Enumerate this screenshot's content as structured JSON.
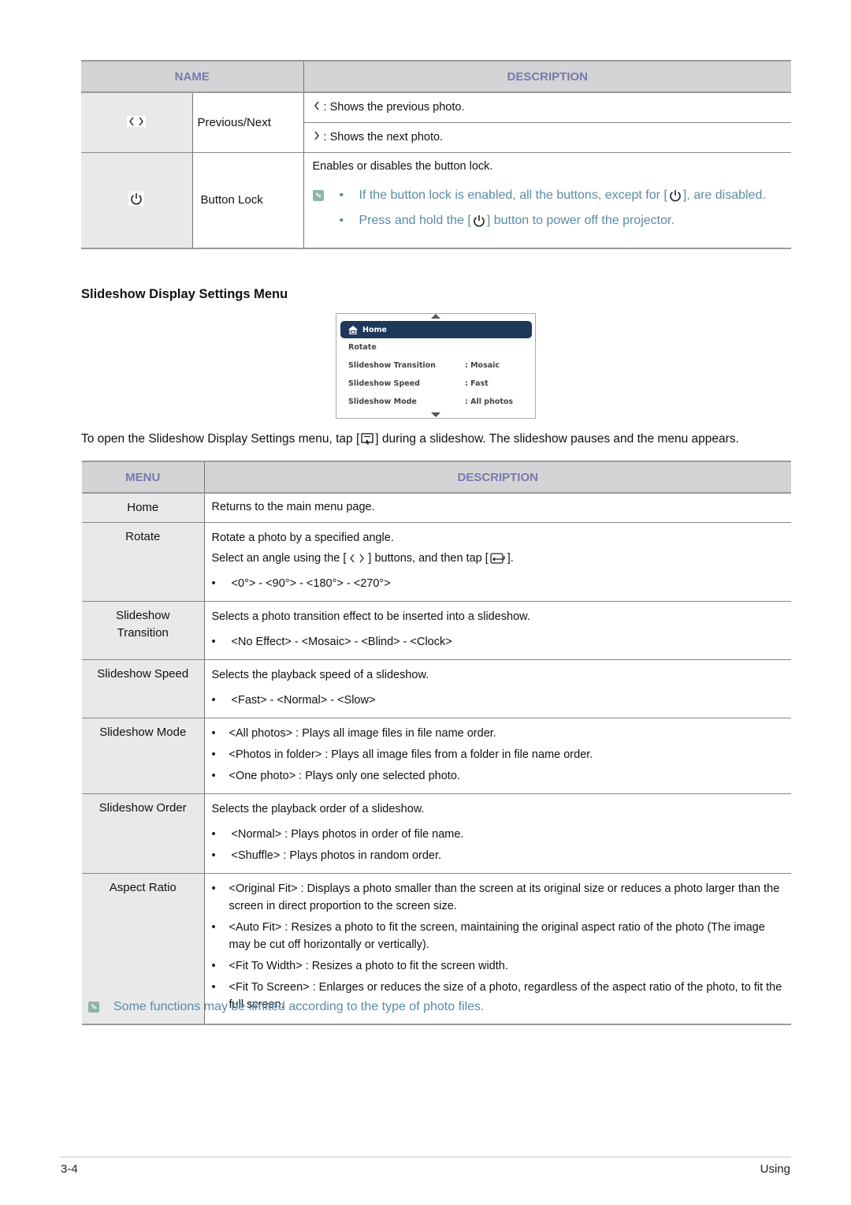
{
  "table1": {
    "headers": {
      "name": "NAME",
      "description": "DESCRIPTION"
    },
    "rows": [
      {
        "icon": "chevron-left-right-icon",
        "name": "Previous/Next",
        "descriptions": [
          {
            "icon": "chevron-left-icon",
            "text": ": Shows the previous photo."
          },
          {
            "icon": "chevron-right-icon",
            "text": ": Shows the next photo."
          }
        ]
      },
      {
        "icon": "power-icon",
        "name": "Button Lock",
        "description": "Enables or disables the button lock.",
        "notes": [
          {
            "before": "If the button lock is enabled, all the buttons, except for [",
            "icon": "power-icon",
            "after": "], are disabled."
          },
          {
            "before": "Press and hold the [",
            "icon": "power-icon",
            "after": "] button to power off the projector."
          }
        ]
      }
    ]
  },
  "section_heading": "Slideshow Display Settings Menu",
  "menu_screenshot": {
    "selected": "Home",
    "items": [
      {
        "label": "Rotate",
        "value": ""
      },
      {
        "label": "Slideshow Transition",
        "value": ": Mosaic"
      },
      {
        "label": "Slideshow Speed",
        "value": ": Fast"
      },
      {
        "label": "Slideshow Mode",
        "value": ": All photos"
      }
    ]
  },
  "intro": {
    "before": "To open the Slideshow Display Settings menu, tap [",
    "icon": "slideshow-menu-icon",
    "after": "] during a slideshow. The slideshow pauses and the menu appears."
  },
  "table2": {
    "headers": {
      "menu": "MENU",
      "description": "DESCRIPTION"
    },
    "rows": [
      {
        "menu": "Home",
        "text": "Returns to the main menu page."
      },
      {
        "menu": "Rotate",
        "text": "Rotate a photo by a specified angle.",
        "text2_before": "Select an angle using the [",
        "text2_mid": "] buttons, and then tap [",
        "text2_after": "].",
        "bullets": [
          "<0°> - <90°> - <180°> - <270°>"
        ]
      },
      {
        "menu": "Slideshow Transition",
        "menu_lines": [
          "Slideshow",
          "Transition"
        ],
        "text": "Selects a photo transition effect to be inserted into a slideshow.",
        "bullets": [
          "<No Effect> - <Mosaic> - <Blind> - <Clock>"
        ]
      },
      {
        "menu": "Slideshow Speed",
        "text": "Selects the playback speed of a slideshow.",
        "bullets": [
          "<Fast> - <Normal> - <Slow>"
        ]
      },
      {
        "menu": "Slideshow Mode",
        "bullets": [
          "<All photos> : Plays all image files in file name order.",
          "<Photos in folder> : Plays all image files from a folder in file name order.",
          "<One photo> : Plays only one selected photo."
        ]
      },
      {
        "menu": "Slideshow Order",
        "text": "Selects the playback order of a slideshow.",
        "bullets": [
          "<Normal> : Plays photos in order of file name.",
          "<Shuffle> : Plays photos in random order."
        ]
      },
      {
        "menu": "Aspect Ratio",
        "bullets": [
          "<Original Fit> : Displays a photo smaller than the screen at its original size or reduces a photo larger than the screen in direct proportion to the screen size.",
          "<Auto Fit> : Resizes a photo to fit the screen, maintaining the original aspect ratio of the photo (The image may be cut off horizontally or vertically).",
          "<Fit To Width> : Resizes a photo to fit the screen width.",
          "<Fit To Screen> : Enlarges or reduces the size of a photo, regardless of the aspect ratio of the photo, to fit the full screen."
        ]
      }
    ]
  },
  "bottom_note": "Some functions may be limited according to the type of photo files.",
  "bullet_char": "•",
  "footer": {
    "page": "3-4",
    "chapter": "Using"
  },
  "colors": {
    "header_bg": "#d4d4d6",
    "header_text": "#7b78ad",
    "note_text": "#5b8aa6",
    "label_bg": "#e9e9e9",
    "menu_highlight": "#1e3859"
  }
}
